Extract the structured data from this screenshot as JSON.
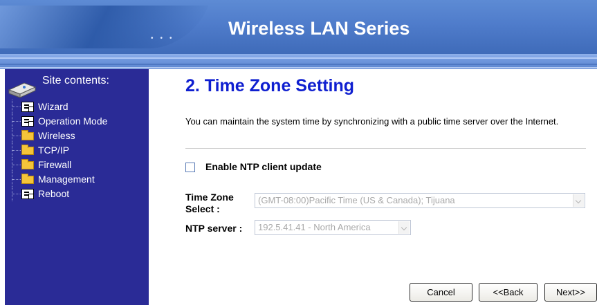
{
  "header": {
    "title": "Wireless LAN Series"
  },
  "sidebar": {
    "title": "Site contents:",
    "items": [
      {
        "label": "Wizard",
        "icon": "page-icon"
      },
      {
        "label": "Operation Mode",
        "icon": "page-icon"
      },
      {
        "label": "Wireless",
        "icon": "folder-icon"
      },
      {
        "label": "TCP/IP",
        "icon": "folder-icon"
      },
      {
        "label": "Firewall",
        "icon": "folder-icon"
      },
      {
        "label": "Management",
        "icon": "folder-icon"
      },
      {
        "label": "Reboot",
        "icon": "page-icon"
      }
    ]
  },
  "main": {
    "title": "2. Time Zone Setting",
    "description": "You can maintain the system time by synchronizing with a public time server over the Internet.",
    "ntp_checkbox_label": "Enable NTP client update",
    "ntp_checkbox_checked": false,
    "time_zone_label": "Time Zone Select :",
    "time_zone_value": "(GMT-08:00)Pacific Time (US & Canada); Tijuana",
    "ntp_server_label": "NTP server :",
    "ntp_server_value": "192.5.41.41 - North America"
  },
  "buttons": {
    "cancel": "Cancel",
    "back": "<<Back",
    "next": "Next>>"
  },
  "colors": {
    "sidebar_bg": "#2a2b96",
    "title_color": "#0f1fd0",
    "header_bg": "#4f7ccb"
  }
}
